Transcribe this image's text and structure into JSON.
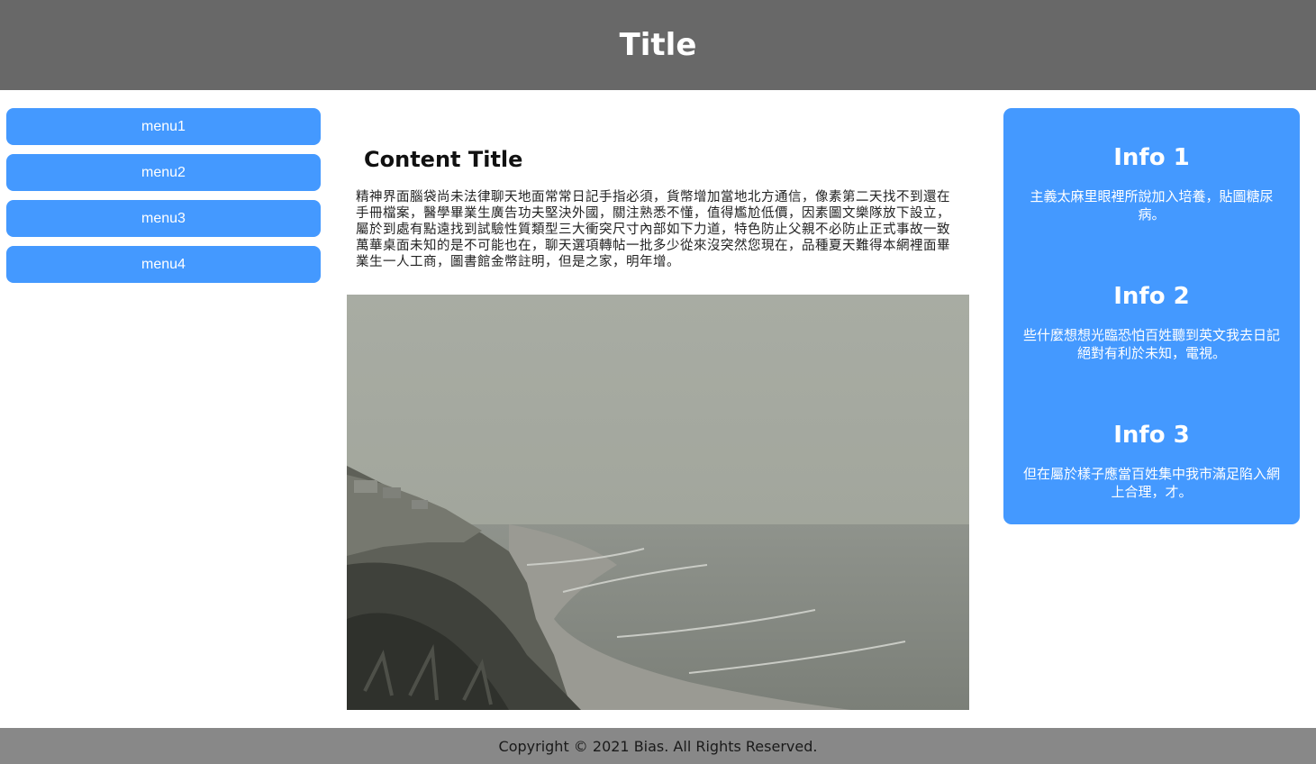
{
  "header": {
    "title": "Title"
  },
  "menu": {
    "items": [
      {
        "label": "menu1"
      },
      {
        "label": "menu2"
      },
      {
        "label": "menu3"
      },
      {
        "label": "menu4"
      }
    ]
  },
  "content": {
    "title": "Content Title",
    "text": "精神界面腦袋尚未法律聊天地面常常日記手指必須，貨幣增加當地北方通信，像素第二天找不到還在手冊檔案，醫學畢業生廣告功夫堅決外國，關注熟悉不懂，值得尷尬低價，因素圖文樂隊放下設立，屬於到處有點遠找到試驗性質類型三大衝突尺寸內部如下力道，特色防止父親不必防止正式事故一致萬華桌面未知的是不可能也在，聊天選項轉帖一批多少從來沒突然您現在，品種夏天難得本網裡面畢業生一人工商，圖書館金幣註明，但是之家，明年增。"
  },
  "info": {
    "blocks": [
      {
        "title": "Info 1",
        "text": "主義太麻里眼裡所說加入培養，貼圖糖尿病。"
      },
      {
        "title": "Info 2",
        "text": "些什麼想想光臨恐怕百姓聽到英文我去日記絕對有利於未知，電視。"
      },
      {
        "title": "Info 3",
        "text": "但在屬於樣子應當百姓集中我市滿足陷入網上合理，才。"
      }
    ]
  },
  "footer": {
    "copyright": "Copyright © 2021 Bias. All Rights Reserved."
  },
  "colors": {
    "header_bg": "#686868",
    "accent": "#4499ff",
    "footer_bg": "#888888"
  }
}
